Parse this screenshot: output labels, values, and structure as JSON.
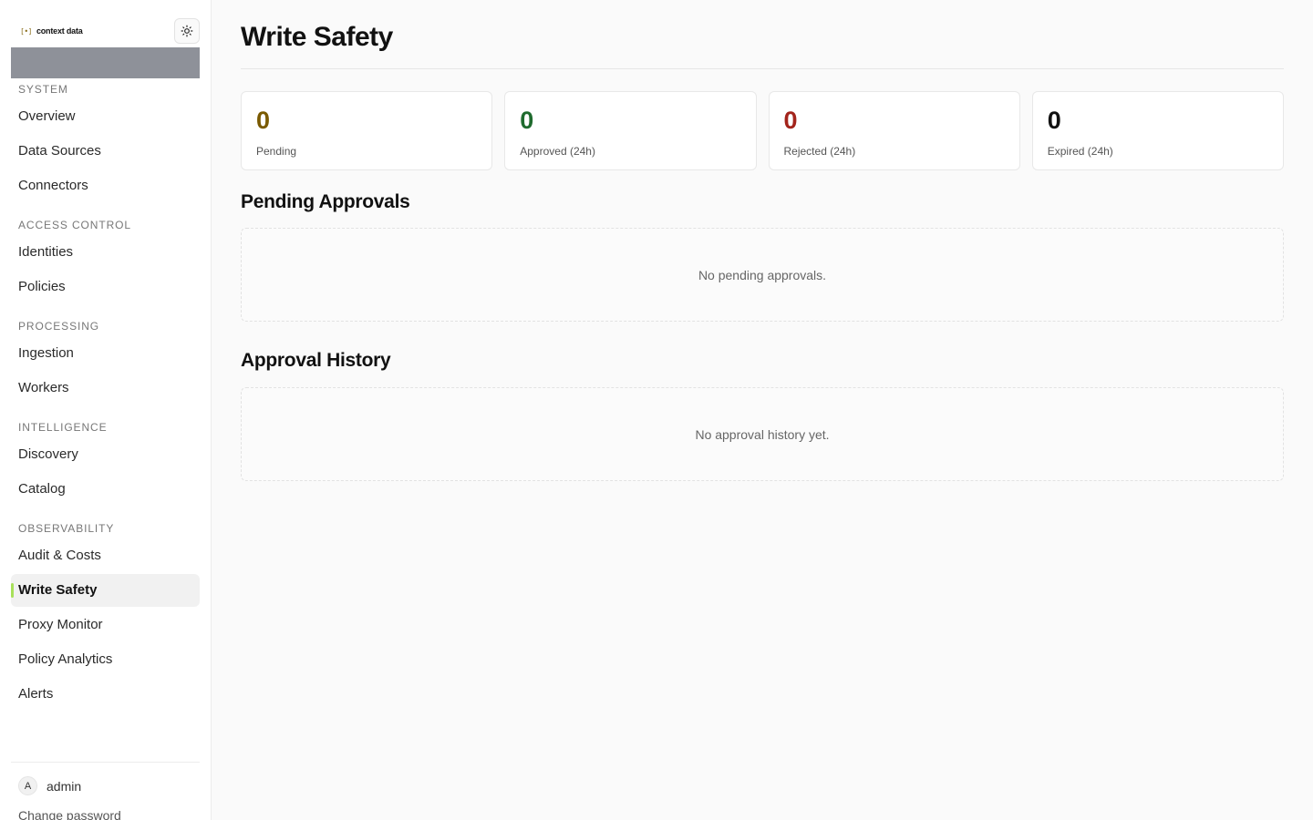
{
  "brand": {
    "mark": "[•]",
    "name": "context data"
  },
  "sidebar": {
    "sections": [
      {
        "label": "SYSTEM",
        "items": [
          "Overview",
          "Data Sources",
          "Connectors"
        ]
      },
      {
        "label": "ACCESS CONTROL",
        "items": [
          "Identities",
          "Policies"
        ]
      },
      {
        "label": "PROCESSING",
        "items": [
          "Ingestion",
          "Workers"
        ]
      },
      {
        "label": "INTELLIGENCE",
        "items": [
          "Discovery",
          "Catalog"
        ]
      },
      {
        "label": "OBSERVABILITY",
        "items": [
          "Audit & Costs",
          "Write Safety",
          "Proxy Monitor",
          "Policy Analytics",
          "Alerts"
        ]
      }
    ],
    "active_item": "Write Safety",
    "accent_color": "#a8e05a"
  },
  "user": {
    "avatar_initial": "A",
    "name": "admin",
    "change_password": "Change password"
  },
  "page": {
    "title": "Write Safety"
  },
  "stats": [
    {
      "value": "0",
      "label": "Pending",
      "color": "#7a5a00"
    },
    {
      "value": "0",
      "label": "Approved (24h)",
      "color": "#1f6b2e"
    },
    {
      "value": "0",
      "label": "Rejected (24h)",
      "color": "#a3241c"
    },
    {
      "value": "0",
      "label": "Expired (24h)",
      "color": "#111111"
    }
  ],
  "pending": {
    "title": "Pending Approvals",
    "empty_text": "No pending approvals."
  },
  "history": {
    "title": "Approval History",
    "empty_text": "No approval history yet."
  },
  "icons": {
    "theme_toggle": "sun-icon"
  }
}
